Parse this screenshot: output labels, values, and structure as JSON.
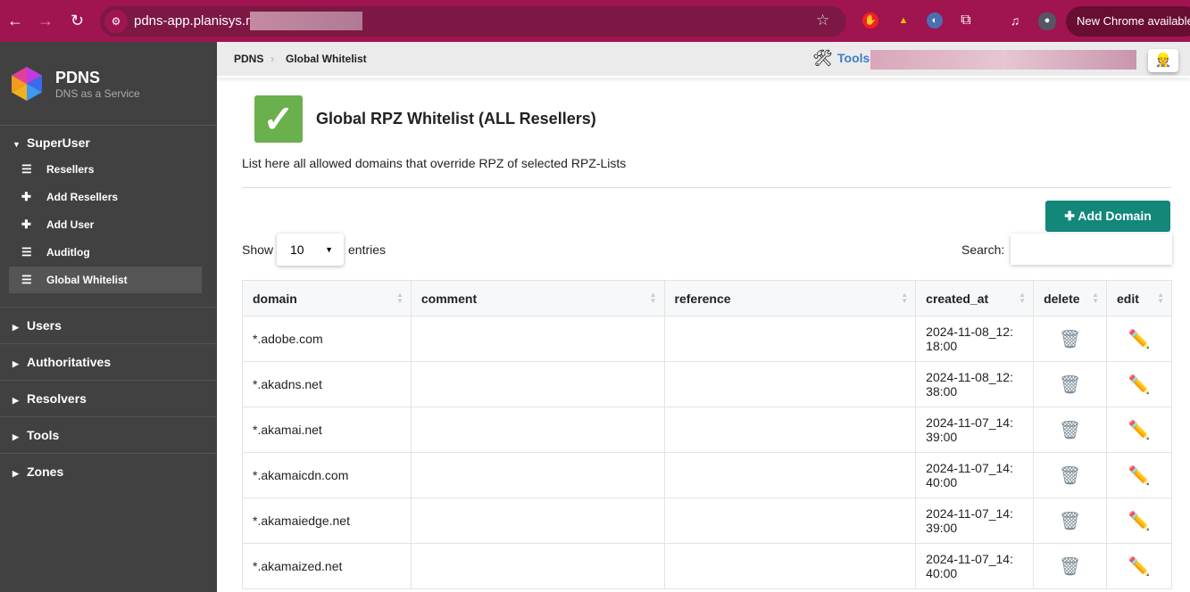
{
  "browser": {
    "url": "pdns-app.planisys.net:",
    "update_label": "New Chrome available"
  },
  "sidebar": {
    "brand": "PDNS",
    "tagline": "DNS as a Service",
    "superuser": {
      "label": "SuperUser",
      "items": [
        {
          "label": "Resellers",
          "icon": "list-icon"
        },
        {
          "label": "Add Resellers",
          "icon": "plus-icon"
        },
        {
          "label": "Add User",
          "icon": "plus-icon"
        },
        {
          "label": "Auditlog",
          "icon": "list-icon"
        },
        {
          "label": "Global Whitelist",
          "icon": "list-icon",
          "active": true
        }
      ]
    },
    "sections": [
      "Users",
      "Authoritatives",
      "Resolvers",
      "Tools",
      "Zones"
    ]
  },
  "header": {
    "breadcrumb": [
      "PDNS",
      "Global Whitelist"
    ],
    "tools_label": "Tools"
  },
  "page": {
    "title": "Global RPZ Whitelist (ALL Resellers)",
    "description": "List here all allowed domains that override RPZ of selected RPZ-Lists",
    "add_button": "Add Domain",
    "show_label": "Show",
    "entries_value": "10",
    "entries_label": "entries",
    "search_label": "Search:",
    "search_value": "",
    "accent": "#12877a"
  },
  "table": {
    "columns": [
      "domain",
      "comment",
      "reference",
      "created_at",
      "delete",
      "edit"
    ],
    "rows": [
      {
        "domain": "*.adobe.com",
        "comment": "",
        "reference": "",
        "created_at": "2024-11-08_12:18:00"
      },
      {
        "domain": "*.akadns.net",
        "comment": "",
        "reference": "",
        "created_at": "2024-11-08_12:38:00"
      },
      {
        "domain": "*.akamai.net",
        "comment": "",
        "reference": "",
        "created_at": "2024-11-07_14:39:00"
      },
      {
        "domain": "*.akamaicdn.com",
        "comment": "",
        "reference": "",
        "created_at": "2024-11-07_14:40:00"
      },
      {
        "domain": "*.akamaiedge.net",
        "comment": "",
        "reference": "",
        "created_at": "2024-11-07_14:39:00"
      },
      {
        "domain": "*.akamaized.net",
        "comment": "",
        "reference": "",
        "created_at": "2024-11-07_14:40:00"
      }
    ]
  }
}
